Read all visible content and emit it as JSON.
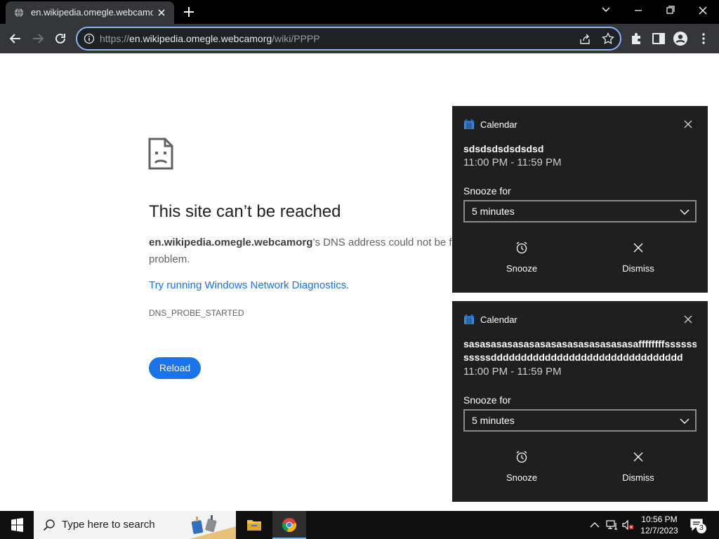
{
  "browser": {
    "tab_title": "en.wikipedia.omegle.webcamorg",
    "url_scheme": "https://",
    "url_host": "en.wikipedia.omegle.webcamorg",
    "url_path": "/wiki/PPPP",
    "accent_color": "#8ab4f8"
  },
  "error_page": {
    "title": "This site can’t be reached",
    "host": "en.wikipedia.omegle.webcamorg",
    "desc_rest": "’s DNS address could not be fo",
    "desc_line2": "problem.",
    "diag_link": "Try running Windows Network Diagnostics.",
    "error_code": "DNS_PROBE_STARTED",
    "reload_label": "Reload"
  },
  "notifications": [
    {
      "app": "Calendar",
      "subject_line1": "sdsdsdsdsdsdsd",
      "subject_line2": "",
      "time": "11:00 PM - 11:59 PM",
      "snooze_label": "Snooze for",
      "snooze_value": "5 minutes",
      "snooze_button": "Snooze",
      "dismiss_button": "Dismiss"
    },
    {
      "app": "Calendar",
      "subject_line1": "sasasasasasasasasasasasasasasasaffffffffssssssss",
      "subject_line2": "sssssdddddddddddddddddddddddddddddddd",
      "time": "11:00 PM - 11:59 PM",
      "snooze_label": "Snooze for",
      "snooze_value": "5 minutes",
      "snooze_button": "Snooze",
      "dismiss_button": "Dismiss"
    }
  ],
  "taskbar": {
    "search_placeholder": "Type here to search",
    "time": "10:56 PM",
    "date": "12/7/2023",
    "notification_count": "3"
  }
}
